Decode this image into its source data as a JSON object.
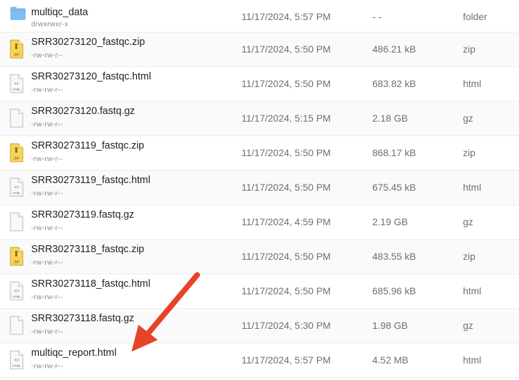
{
  "files": [
    {
      "name": "multiqc_data",
      "perm": "drwxrwxr-x",
      "date": "11/17/2024, 5:57 PM",
      "size": "- -",
      "type": "folder",
      "icon": "folder-icon"
    },
    {
      "name": "SRR30273120_fastqc.zip",
      "perm": "-rw-rw-r--",
      "date": "11/17/2024, 5:50 PM",
      "size": "486.21 kB",
      "type": "zip",
      "icon": "zip-file-icon"
    },
    {
      "name": "SRR30273120_fastqc.html",
      "perm": "-rw-rw-r--",
      "date": "11/17/2024, 5:50 PM",
      "size": "683.82 kB",
      "type": "html",
      "icon": "html-file-icon"
    },
    {
      "name": "SRR30273120.fastq.gz",
      "perm": "-rw-rw-r--",
      "date": "11/17/2024, 5:15 PM",
      "size": "2.18 GB",
      "type": "gz",
      "icon": "file-icon"
    },
    {
      "name": "SRR30273119_fastqc.zip",
      "perm": "-rw-rw-r--",
      "date": "11/17/2024, 5:50 PM",
      "size": "868.17 kB",
      "type": "zip",
      "icon": "zip-file-icon"
    },
    {
      "name": "SRR30273119_fastqc.html",
      "perm": "-rw-rw-r--",
      "date": "11/17/2024, 5:50 PM",
      "size": "675.45 kB",
      "type": "html",
      "icon": "html-file-icon"
    },
    {
      "name": "SRR30273119.fastq.gz",
      "perm": "-rw-rw-r--",
      "date": "11/17/2024, 4:59 PM",
      "size": "2.19 GB",
      "type": "gz",
      "icon": "file-icon"
    },
    {
      "name": "SRR30273118_fastqc.zip",
      "perm": "-rw-rw-r--",
      "date": "11/17/2024, 5:50 PM",
      "size": "483.55 kB",
      "type": "zip",
      "icon": "zip-file-icon"
    },
    {
      "name": "SRR30273118_fastqc.html",
      "perm": "-rw-rw-r--",
      "date": "11/17/2024, 5:50 PM",
      "size": "685.96 kB",
      "type": "html",
      "icon": "html-file-icon"
    },
    {
      "name": "SRR30273118.fastq.gz",
      "perm": "-rw-rw-r--",
      "date": "11/17/2024, 5:30 PM",
      "size": "1.98 GB",
      "type": "gz",
      "icon": "file-icon"
    },
    {
      "name": "multiqc_report.html",
      "perm": "-rw-rw-r--",
      "date": "11/17/2024, 5:57 PM",
      "size": "4.52 MB",
      "type": "html",
      "icon": "html-file-icon"
    }
  ],
  "annotation": {
    "color": "#e8432a",
    "icon": "red-arrow-icon"
  },
  "colors": {
    "folder": "#7dbdf0",
    "zip": "#f2c84b",
    "file_border": "#b9b9b9"
  }
}
